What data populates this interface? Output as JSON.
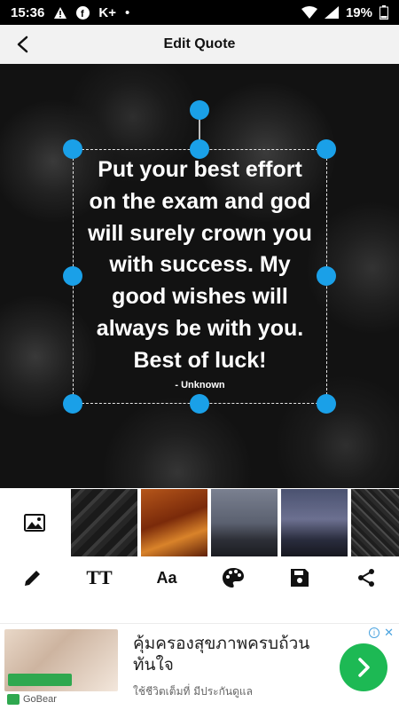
{
  "status_bar": {
    "time": "15:36",
    "carrier_badge": "K+",
    "dot": "•",
    "battery": "19%",
    "icons": [
      "warning-icon",
      "facebook-icon",
      "wifi-icon",
      "signal-icon",
      "battery-icon"
    ]
  },
  "app_bar": {
    "title": "Edit Quote",
    "back_icon": "back-arrow-icon"
  },
  "quote": {
    "text_lines": [
      "Put your best effort",
      "on the exam and god",
      "will surely crown you",
      "with success. My",
      "good wishes will",
      "always be with you.",
      "Best of luck!"
    ],
    "author": "- Unknown",
    "handle_color": "#1aa0e8"
  },
  "backgrounds": {
    "gallery_icon": "image-icon",
    "thumbnails": [
      "dark-pattern",
      "orange-grass",
      "foggy-forest",
      "purple-forest",
      "dark-texture"
    ]
  },
  "toolbar": {
    "tools": [
      {
        "name": "edit-text",
        "icon": "pencil-icon"
      },
      {
        "name": "text-size",
        "icon": "text-size-icon",
        "label": "TT"
      },
      {
        "name": "font",
        "icon": "font-icon",
        "label": "Aa"
      },
      {
        "name": "color",
        "icon": "palette-icon"
      },
      {
        "name": "save",
        "icon": "save-icon"
      },
      {
        "name": "share",
        "icon": "share-icon"
      }
    ]
  },
  "ad": {
    "headline": "คุ้มครองสุขภาพครบถ้วน ทันใจ",
    "subtext": "ใช้ชีวิตเต็มที่ มีประกันดูแล",
    "brand": "GoBear",
    "cta_icon": "chevron-right-icon",
    "info_icon": "info-icon",
    "close_icon": "close-icon",
    "cta_color": "#1db954"
  }
}
